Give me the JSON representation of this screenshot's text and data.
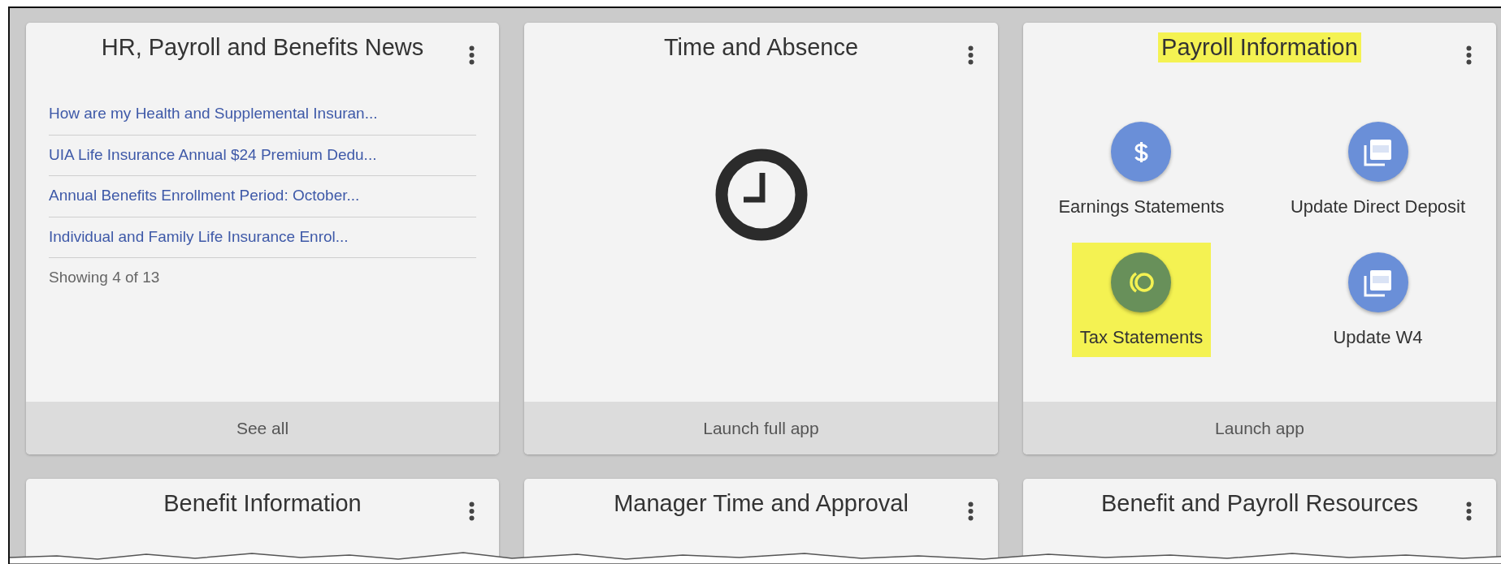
{
  "cards": [
    {
      "kind": "news",
      "title": "HR, Payroll and Benefits News",
      "highlighted": false,
      "links": [
        "How are my Health and Supplemental Insuran...",
        "UIA Life Insurance Annual $24 Premium Dedu...",
        "Annual Benefits Enrollment Period: October...",
        "Individual and Family Life Insurance Enrol..."
      ],
      "summary": "Showing 4 of 13",
      "footer": "See all"
    },
    {
      "kind": "clock",
      "title": "Time and Absence",
      "highlighted": false,
      "footer": "Launch full app"
    },
    {
      "kind": "apps",
      "title": "Payroll Information",
      "highlighted": true,
      "apps": [
        {
          "kind": "dollar",
          "label": "Earnings Statements",
          "color": "#6a8fd8",
          "highlighted": false
        },
        {
          "kind": "pdf",
          "label": "Update Direct Deposit",
          "color": "#6a8fd8",
          "highlighted": false
        },
        {
          "kind": "coins",
          "label": "Tax Statements",
          "color": "#68905a",
          "highlighted": true
        },
        {
          "kind": "pdf",
          "label": "Update W4",
          "color": "#6a8fd8",
          "highlighted": false
        }
      ],
      "footer": "Launch app"
    },
    {
      "kind": "partial",
      "title": "Benefit Information",
      "highlighted": false
    },
    {
      "kind": "partial",
      "title": "Manager Time and Approval",
      "highlighted": false
    },
    {
      "kind": "partial",
      "title": "Benefit and Payroll Resources",
      "highlighted": false
    }
  ]
}
